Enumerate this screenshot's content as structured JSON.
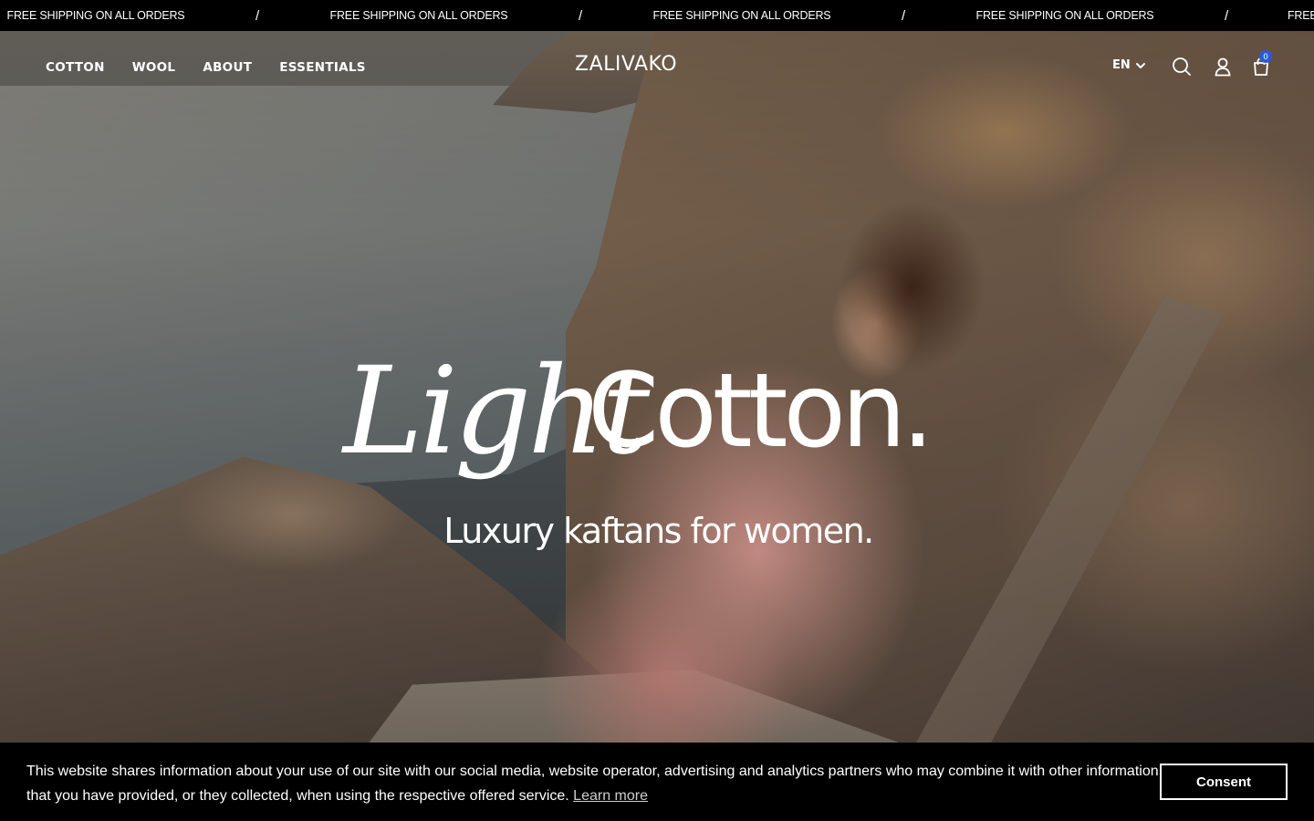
{
  "announcement": {
    "messages": [
      "FREE SHIPPING ON ALL ORDERS",
      "FREE SHIPPING ON ALL ORDERS",
      "FREE SHIPPING ON ALL ORDERS",
      "FREE SHIPPING ON ALL ORDERS",
      "FREE"
    ],
    "separator": "/"
  },
  "header": {
    "nav": [
      "COTTON",
      "WOOL",
      "ABOUT",
      "ESSENTIALS"
    ],
    "logo": "ZALIVAKO",
    "language": "EN",
    "cart_count": "0"
  },
  "hero": {
    "headline_script": "Light",
    "headline_main": "Cotton.",
    "subheadline": "Luxury kaftans for women."
  },
  "cookie_banner": {
    "text": "This website shares information about your use of our site with our social media, website operator, advertising and analytics partners who may combine it with other information that you have provided, or they collected, when using the respective offered service.",
    "learn_more": "Learn more",
    "consent": "Consent"
  },
  "icons": [
    "chevron-down-icon",
    "search-icon",
    "account-icon",
    "cart-icon"
  ],
  "colors": {
    "accent_badge": "#2a5bd7",
    "banner_bg": "#000000",
    "text": "#ffffff"
  }
}
